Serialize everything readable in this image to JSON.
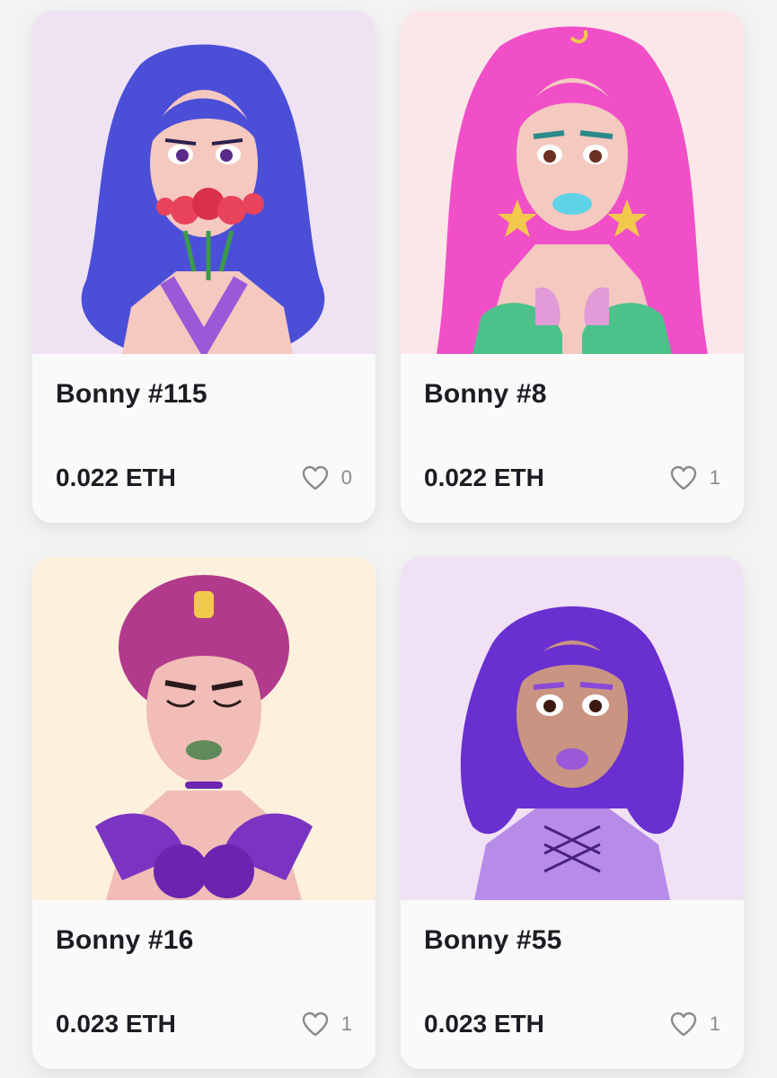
{
  "cards": [
    {
      "name": "Bonny #115",
      "price": "0.022 ETH",
      "likes": "0",
      "bg": "#efe3f3",
      "hair": "#4b4fd8",
      "skin": "#f5c8c0",
      "accent": "#e8435a"
    },
    {
      "name": "Bonny #8",
      "price": "0.022 ETH",
      "likes": "1",
      "bg": "#fbe7e8",
      "hair": "#f04fc7",
      "skin": "#f3c9c0",
      "accent": "#5ed3e8"
    },
    {
      "name": "Bonny #16",
      "price": "0.023 ETH",
      "likes": "1",
      "bg": "#fdf1dd",
      "hair": "#b13a8c",
      "skin": "#f1bdb6",
      "accent": "#7b34c2"
    },
    {
      "name": "Bonny #55",
      "price": "0.023 ETH",
      "likes": "1",
      "bg": "#f0e1f4",
      "hair": "#6a2fd0",
      "skin": "#c99582",
      "accent": "#b78be8"
    }
  ],
  "icons": {
    "like": "heart-outline-icon"
  }
}
